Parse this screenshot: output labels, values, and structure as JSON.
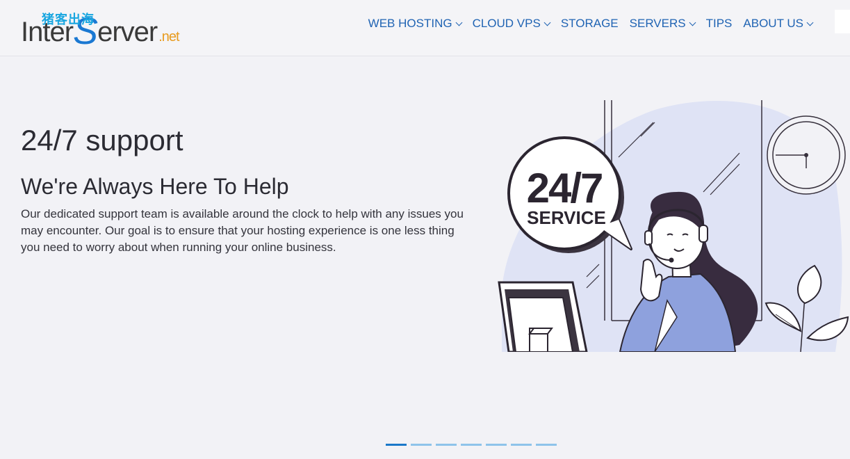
{
  "header": {
    "logo_prefix": "Inter",
    "logo_s": "S",
    "logo_suffix": "erver",
    "logo_tld": ".net",
    "watermark": "猪客出海",
    "nav": [
      {
        "label": "WEB HOSTING",
        "dropdown": true
      },
      {
        "label": "CLOUD VPS",
        "dropdown": true
      },
      {
        "label": "STORAGE",
        "dropdown": false
      },
      {
        "label": "SERVERS",
        "dropdown": true
      },
      {
        "label": "TIPS",
        "dropdown": false
      },
      {
        "label": "ABOUT US",
        "dropdown": true
      }
    ]
  },
  "hero": {
    "title": "24/7 support",
    "subtitle": "We're Always Here To Help",
    "description": "Our dedicated support team is available around the clock to help with any issues you may encounter. Our goal is to ensure that your hosting experience is one less thing you need to worry about when running your online business.",
    "badge_line1": "24/7",
    "badge_line2": "SERVICE"
  },
  "carousel": {
    "count": 7,
    "active_index": 0
  },
  "colors": {
    "nav": "#1f63b3",
    "accent": "#1b78c9",
    "background": "#f2f2f6"
  }
}
